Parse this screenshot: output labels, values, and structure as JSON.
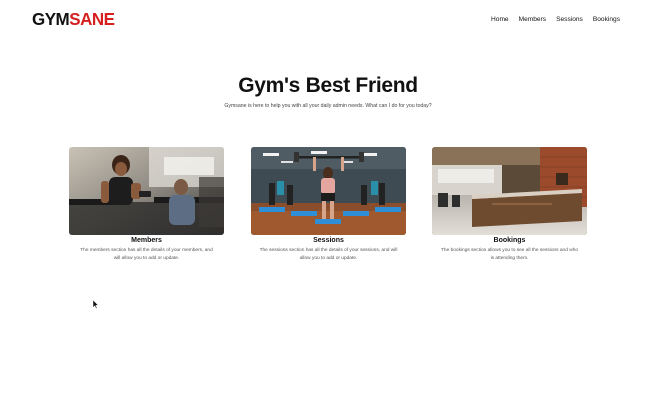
{
  "brand": {
    "logo_part1": "GYM",
    "logo_part2": "SANE",
    "accent_color": "#d61f1f"
  },
  "nav": {
    "items": [
      {
        "label": "Home"
      },
      {
        "label": "Members"
      },
      {
        "label": "Sessions"
      },
      {
        "label": "Bookings"
      }
    ]
  },
  "hero": {
    "title": "Gym's Best Friend",
    "subtitle": "Gymsane is here to help you with all your daily admin needs. What can I do for you today?"
  },
  "cards": [
    {
      "title": "Members",
      "description": "The members section has all the details of your members, and will allow you to add or update.",
      "image_icon": "gym-members-photo"
    },
    {
      "title": "Sessions",
      "description": "The sessions section has all the details of your sessions, and will allow you to add or update.",
      "image_icon": "gym-class-photo"
    },
    {
      "title": "Bookings",
      "description": "The bookings section allows you to see all the sessions and who is attending them.",
      "image_icon": "gym-reception-photo"
    }
  ]
}
